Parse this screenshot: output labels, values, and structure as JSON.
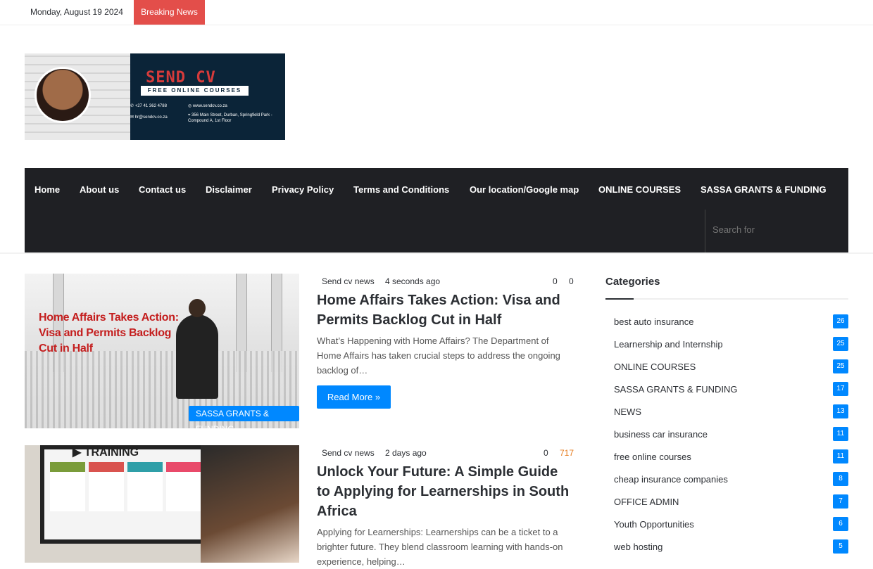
{
  "topbar": {
    "date": "Monday, August 19 2024",
    "breaking_label": "Breaking News"
  },
  "logo": {
    "title": "SEND CV",
    "subtitle": "FREE ONLINE COURSES",
    "phone": "+27 41 362 4788",
    "email": "hr@sendcv.co.za",
    "website": "www.sendcv.co.za",
    "address": "356 Main Street, Durban, Springfield Park - Compound A, 1st Floor"
  },
  "nav": {
    "items": [
      "Home",
      "About us",
      "Contact us",
      "Disclaimer",
      "Privacy Policy",
      "Terms and Conditions",
      "Our location/Google map",
      "ONLINE COURSES",
      "SASSA GRANTS & FUNDING"
    ],
    "search_placeholder": "Search for"
  },
  "posts": [
    {
      "image_text": "Home Affairs Takes Action: Visa and Permits Backlog Cut in Half",
      "category_tag": "SASSA GRANTS & FUNDING",
      "author": "Send cv news",
      "time": "4 seconds ago",
      "comments": "0",
      "views": "0",
      "title": "Home Affairs Takes Action: Visa and Permits Backlog Cut in Half",
      "excerpt": "What’s Happening with Home Affairs? The Department of Home Affairs has taken crucial steps to address the ongoing backlog of…",
      "read_more": "Read More »"
    },
    {
      "image_text": "TRAINING",
      "author": "Send cv news",
      "time": "2 days ago",
      "comments": "0",
      "views": "717",
      "title": "Unlock Your Future: A Simple Guide to Applying for Learnerships in South Africa",
      "excerpt": "Applying for Learnerships: Learnerships can be a ticket to a brighter future. They blend classroom learning with hands-on experience, helping…"
    }
  ],
  "sidebar": {
    "title": "Categories",
    "categories": [
      {
        "name": "best auto insurance",
        "count": "26"
      },
      {
        "name": "Learnership and Internship",
        "count": "25"
      },
      {
        "name": "ONLINE COURSES",
        "count": "25"
      },
      {
        "name": "SASSA GRANTS & FUNDING",
        "count": "17"
      },
      {
        "name": "NEWS",
        "count": "13"
      },
      {
        "name": "business car insurance",
        "count": "11"
      },
      {
        "name": "free online courses",
        "count": "11"
      },
      {
        "name": "cheap insurance companies",
        "count": "8"
      },
      {
        "name": "OFFICE ADMIN",
        "count": "7"
      },
      {
        "name": "Youth Opportunities",
        "count": "6"
      },
      {
        "name": "web hosting",
        "count": "5"
      }
    ]
  },
  "colors": {
    "accent": "#0088ff",
    "breaking": "#e34e4a",
    "nav_bg": "#1f2024",
    "views_highlight": "#e67e22"
  }
}
